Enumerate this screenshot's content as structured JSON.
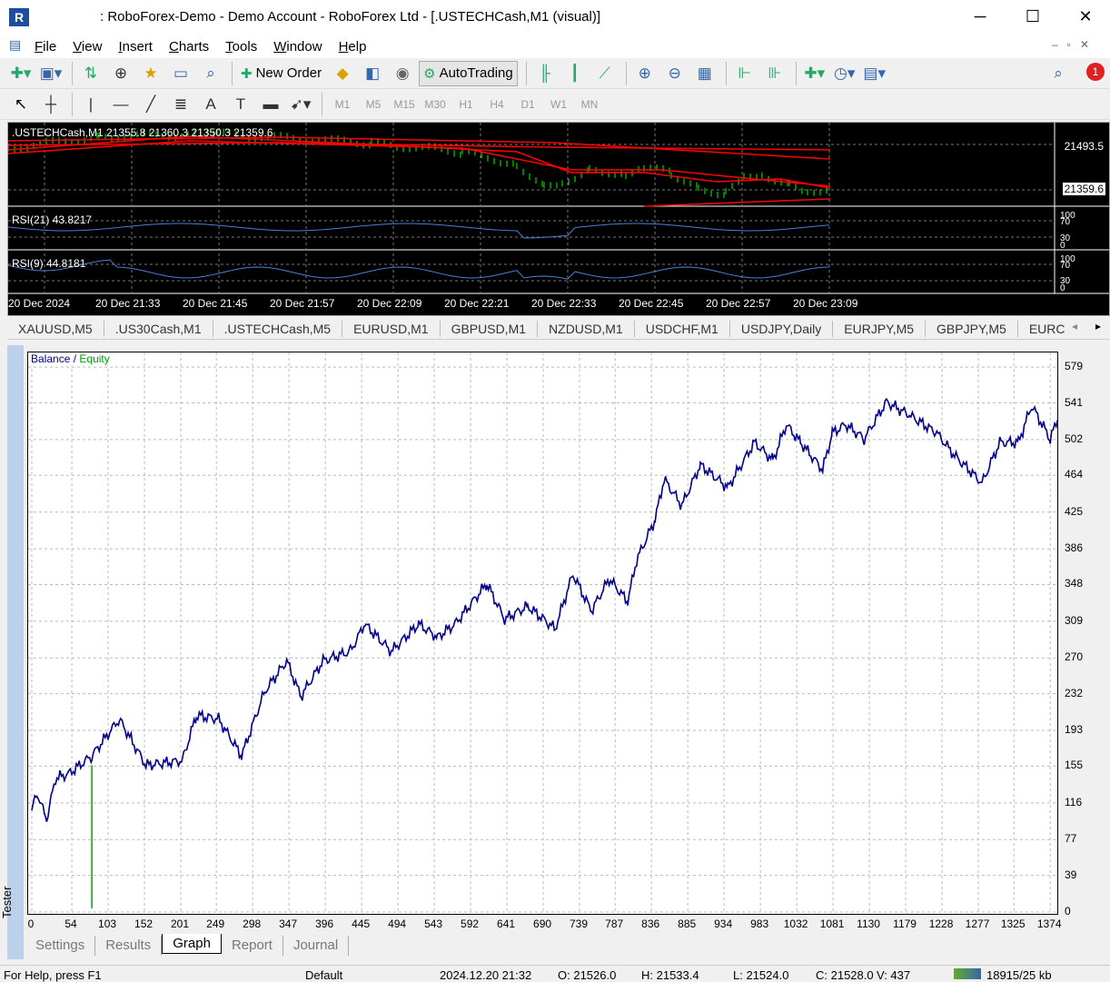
{
  "window": {
    "title": ": RoboForex-Demo - Demo Account - RoboForex Ltd - [.USTECHCash,M1 (visual)]",
    "minimize": "─",
    "maximize": "☐",
    "close": "✕"
  },
  "menu": [
    "File",
    "View",
    "Insert",
    "Charts",
    "Tools",
    "Window",
    "Help"
  ],
  "toolbar": {
    "new_order": "New Order",
    "autotrading": "AutoTrading",
    "notification_count": "1"
  },
  "timeframes": [
    "M1",
    "M5",
    "M15",
    "M30",
    "H1",
    "H4",
    "D1",
    "W1",
    "MN"
  ],
  "chart": {
    "header": ".USTECHCash,M1  21355.8 21360.3 21350.3 21359.6",
    "price_high": "21493.5",
    "price_current": "21359.6",
    "rsi21": "RSI(21) 43.8217",
    "rsi9": "RSI(9) 44.8181",
    "rsi_levels": [
      "100",
      "70",
      "30",
      "0"
    ],
    "time_labels": [
      "20 Dec 2024",
      "20 Dec 21:33",
      "20 Dec 21:45",
      "20 Dec 21:57",
      "20 Dec 22:09",
      "20 Dec 22:21",
      "20 Dec 22:33",
      "20 Dec 22:45",
      "20 Dec 22:57",
      "20 Dec 23:09"
    ],
    "colors": {
      "bars": "#00ff00",
      "ma": "#ff0000",
      "rsi": "#4a7fd8"
    }
  },
  "chart_tabs": [
    "XAUUSD,M5",
    ".US30Cash,M1",
    ".USTECHCash,M5",
    "EURUSD,M1",
    "GBPUSD,M1",
    "NZDUSD,M1",
    "USDCHF,M1",
    "USDJPY,Daily",
    "EURJPY,M5",
    "GBPJPY,M5",
    "EURC"
  ],
  "tester": {
    "side_label": "Tester",
    "tabs": [
      "Settings",
      "Results",
      "Graph",
      "Report",
      "Journal"
    ],
    "active_tab": "Graph"
  },
  "chart_data": {
    "type": "line",
    "legend": {
      "balance": "Balance",
      "separator": " / ",
      "equity": "Equity"
    },
    "colors": {
      "balance": "#00008b",
      "equity": "#00a000"
    },
    "grid": true,
    "y_ticks": [
      0,
      39,
      77,
      116,
      155,
      193,
      232,
      270,
      309,
      348,
      386,
      425,
      464,
      502,
      541,
      579
    ],
    "x_ticks": [
      0,
      54,
      103,
      152,
      201,
      249,
      298,
      347,
      396,
      445,
      494,
      543,
      592,
      641,
      690,
      739,
      787,
      836,
      885,
      934,
      983,
      1032,
      1081,
      1130,
      1179,
      1228,
      1277,
      1325,
      1374
    ],
    "ylim": [
      0,
      579
    ],
    "xlim": [
      0,
      1384
    ],
    "series": [
      {
        "name": "Balance",
        "points": [
          [
            0,
            108
          ],
          [
            7,
            127
          ],
          [
            20,
            98
          ],
          [
            32,
            142
          ],
          [
            50,
            147
          ],
          [
            81,
            166
          ],
          [
            118,
            205
          ],
          [
            154,
            156
          ],
          [
            203,
            161
          ],
          [
            222,
            209
          ],
          [
            252,
            205
          ],
          [
            283,
            166
          ],
          [
            314,
            234
          ],
          [
            344,
            267
          ],
          [
            363,
            229
          ],
          [
            393,
            267
          ],
          [
            430,
            277
          ],
          [
            449,
            306
          ],
          [
            485,
            277
          ],
          [
            522,
            306
          ],
          [
            547,
            292
          ],
          [
            571,
            306
          ],
          [
            614,
            349
          ],
          [
            638,
            311
          ],
          [
            669,
            325
          ],
          [
            706,
            301
          ],
          [
            730,
            359
          ],
          [
            755,
            320
          ],
          [
            779,
            354
          ],
          [
            804,
            330
          ],
          [
            816,
            374
          ],
          [
            841,
            417
          ],
          [
            853,
            460
          ],
          [
            877,
            432
          ],
          [
            902,
            475
          ],
          [
            939,
            451
          ],
          [
            975,
            499
          ],
          [
            1000,
            480
          ],
          [
            1018,
            518
          ],
          [
            1037,
            499
          ],
          [
            1067,
            470
          ],
          [
            1080,
            509
          ],
          [
            1098,
            518
          ],
          [
            1123,
            503
          ],
          [
            1153,
            542
          ],
          [
            1184,
            528
          ],
          [
            1221,
            509
          ],
          [
            1245,
            485
          ],
          [
            1282,
            456
          ],
          [
            1306,
            499
          ],
          [
            1331,
            499
          ],
          [
            1349,
            538
          ],
          [
            1374,
            503
          ],
          [
            1384,
            523
          ]
        ]
      },
      {
        "name": "Equity",
        "points": [
          [
            81,
            156
          ],
          [
            81,
            4
          ]
        ]
      }
    ]
  },
  "status": {
    "help": "For Help, press F1",
    "profile": "Default",
    "datetime": "2024.12.20 21:32",
    "open": "O: 21526.0",
    "high": "H: 21533.4",
    "low": "L: 21524.0",
    "close": "C: 21528.0",
    "volume": "V: 437",
    "traffic": "18915/25 kb"
  }
}
